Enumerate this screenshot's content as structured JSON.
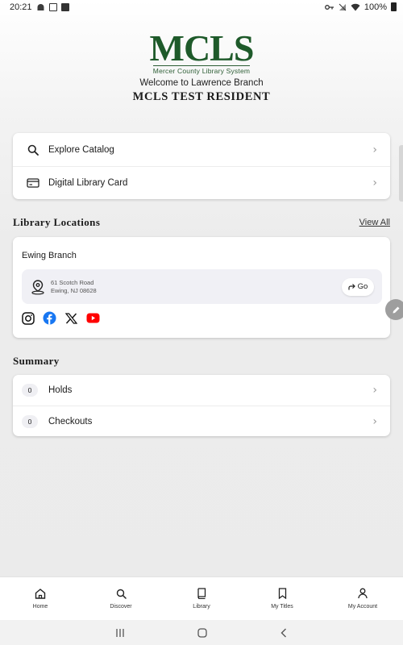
{
  "status_bar": {
    "time": "20:21",
    "battery": "100%"
  },
  "header": {
    "logo_text": "MCLS",
    "logo_tagline": "Mercer County Library System",
    "welcome": "Welcome to Lawrence Branch",
    "user_name": "MCLS TEST RESIDENT"
  },
  "quick_links": [
    {
      "label": "Explore Catalog",
      "icon": "search-icon"
    },
    {
      "label": "Digital Library Card",
      "icon": "card-icon"
    }
  ],
  "locations": {
    "title": "Library Locations",
    "view_all": "View All",
    "branch": {
      "name": "Ewing Branch",
      "address_line1": "61 Scotch Road",
      "address_line2": "Ewing, NJ 08628",
      "go_label": "Go"
    },
    "socials": [
      "instagram-icon",
      "facebook-icon",
      "x-icon",
      "youtube-icon"
    ]
  },
  "summary": {
    "title": "Summary",
    "items": [
      {
        "count": "0",
        "label": "Holds"
      },
      {
        "count": "0",
        "label": "Checkouts"
      }
    ]
  },
  "bottom_nav": [
    {
      "label": "Home",
      "icon": "home-icon",
      "active": true
    },
    {
      "label": "Discover",
      "icon": "search-icon"
    },
    {
      "label": "Library",
      "icon": "book-icon"
    },
    {
      "label": "My Titles",
      "icon": "bookmark-icon"
    },
    {
      "label": "My Account",
      "icon": "person-icon"
    }
  ],
  "colors": {
    "brand_green": "#1e5a2a",
    "facebook": "#1877f2",
    "youtube": "#ff0000"
  }
}
